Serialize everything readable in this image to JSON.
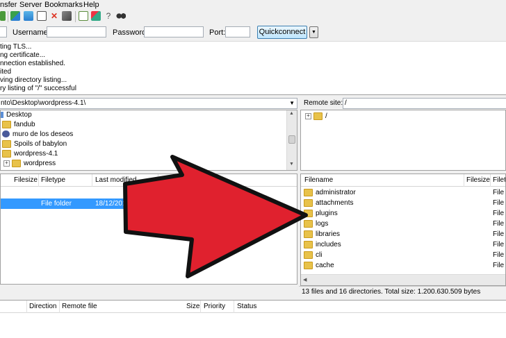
{
  "menu": [
    "nsfer",
    "Server",
    "Bookmarks",
    "Help"
  ],
  "quickconnect": {
    "username_label": "Username:",
    "password_label": "Password:",
    "port_label": "Port:",
    "button_label": "Quickconnect",
    "dropdown_arrow": "▼"
  },
  "log_lines": [
    "ting TLS...",
    "ng certificate...",
    "nnection established.",
    "ited",
    "ving directory listing...",
    "ry listing of \"/\" successful"
  ],
  "local": {
    "path": "nto\\Desktop\\wordpress-4.1\\",
    "tree": [
      {
        "label": "Desktop",
        "icon": "desktop-icon"
      },
      {
        "label": "fandub",
        "icon": "folder-icon"
      },
      {
        "label": "muro de los deseos",
        "icon": "people-icon"
      },
      {
        "label": "Spoils of babylon",
        "icon": "folder-icon"
      },
      {
        "label": "wordpress-4.1",
        "icon": "folder-icon"
      },
      {
        "label": "wordpress",
        "icon": "folder-icon",
        "expander": "+"
      }
    ],
    "columns": [
      "Filesize",
      "Filetype",
      "Last modified"
    ],
    "rows": [
      {
        "filetype": "File folder",
        "modified": "18/12/2014 06:10:2"
      }
    ]
  },
  "remote": {
    "site_label": "Remote site:",
    "path": "/",
    "tree_root": "/",
    "columns": [
      "Filename",
      "Filesize",
      "Filety"
    ],
    "rows": [
      {
        "name": "administrator",
        "type": "File f"
      },
      {
        "name": "attachments",
        "type": "File f"
      },
      {
        "name": "plugins",
        "type": "File f"
      },
      {
        "name": "logs",
        "type": "File f"
      },
      {
        "name": "libraries",
        "type": "File f"
      },
      {
        "name": "includes",
        "type": "File f"
      },
      {
        "name": "cli",
        "type": "File f"
      },
      {
        "name": "cache",
        "type": "File f"
      }
    ],
    "status": "13 files and 16 directories. Total size: 1.200.630.509 bytes"
  },
  "queue": {
    "columns": [
      "Direction",
      "Remote file",
      "Size",
      "Priority",
      "Status"
    ]
  },
  "colors": {
    "arrow": "#e0212e",
    "selection": "#3399ff",
    "folder": "#e8c24a"
  }
}
